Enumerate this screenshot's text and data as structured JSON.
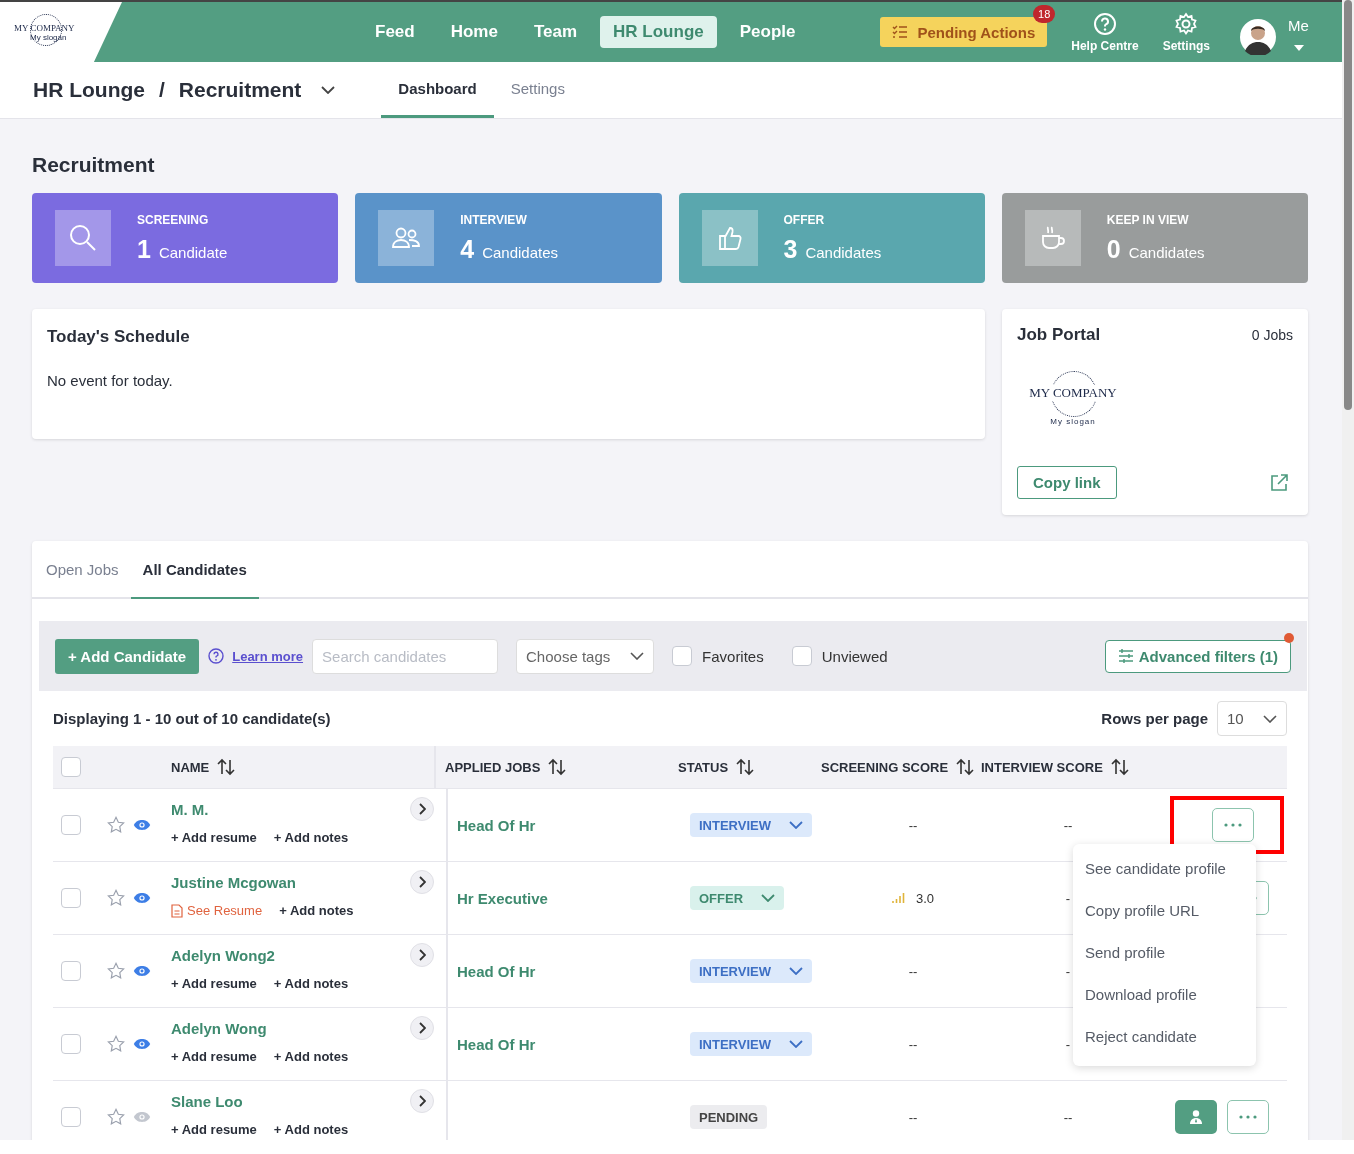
{
  "nav": {
    "logo": {
      "name": "MY COMPANY",
      "slogan": "My slogan"
    },
    "items": [
      {
        "label": "Feed",
        "selected": false
      },
      {
        "label": "Home",
        "selected": false
      },
      {
        "label": "Team",
        "selected": false
      },
      {
        "label": "HR Lounge",
        "selected": true
      },
      {
        "label": "People",
        "selected": false
      }
    ],
    "pending": {
      "label": "Pending Actions",
      "count": "18"
    },
    "tools": [
      {
        "kind": "help",
        "label": "Help Centre"
      },
      {
        "kind": "settings",
        "label": "Settings"
      }
    ],
    "user": {
      "label": "Me"
    }
  },
  "breadcrumb": {
    "section": "HR Lounge",
    "separator": "/",
    "page": "Recruitment"
  },
  "page_tabs": [
    {
      "label": "Dashboard",
      "selected": true
    },
    {
      "label": "Settings",
      "selected": false
    }
  ],
  "heading": "Recruitment",
  "stages": [
    {
      "kind": "screening",
      "title": "SCREENING",
      "count": "1",
      "unit": "Candidate",
      "color": "#7b6be0"
    },
    {
      "kind": "interview",
      "title": "INTERVIEW",
      "count": "4",
      "unit": "Candidates",
      "color": "#5a93c9"
    },
    {
      "kind": "offer",
      "title": "OFFER",
      "count": "3",
      "unit": "Candidates",
      "color": "#5aa7ae"
    },
    {
      "kind": "keep",
      "title": "KEEP IN VIEW",
      "count": "0",
      "unit": "Candidates",
      "color": "#999c9c"
    }
  ],
  "schedule": {
    "title": "Today's Schedule",
    "message": "No event for today."
  },
  "job_portal": {
    "title": "Job Portal",
    "count": "0 Jobs",
    "logo": {
      "name": "MY COMPANY",
      "slogan": "My slogan"
    },
    "button": "Copy link"
  },
  "candidate_tabs": [
    {
      "label": "Open Jobs",
      "selected": false
    },
    {
      "label": "All Candidates",
      "selected": true
    }
  ],
  "toolbar": {
    "add_button": "+ Add Candidate",
    "learn_more": "Learn more",
    "search": {
      "placeholder": "Search candidates"
    },
    "tags": {
      "placeholder": "Choose tags"
    },
    "filters": [
      {
        "label": "Favorites",
        "checked": false
      },
      {
        "label": "Unviewed",
        "checked": false
      }
    ],
    "advanced": {
      "label": "Advanced filters (1)",
      "alert": true
    }
  },
  "summary": "Displaying 1 - 10 out of 10 candidate(s)",
  "rows_per_page": {
    "label": "Rows per page",
    "value": "10"
  },
  "table": {
    "select_all_checked": false,
    "columns": [
      "NAME",
      "APPLIED JOBS",
      "STATUS",
      "SCREENING SCORE",
      "INTERVIEW SCORE"
    ],
    "rows": [
      {
        "name": "M. M.",
        "checked": false,
        "favorite": false,
        "viewed": true,
        "resume": {
          "kind": "add",
          "label": "+ Add resume"
        },
        "notes": "+ Add notes",
        "job": "Head Of Hr",
        "status": {
          "kind": "interview",
          "label": "INTERVIEW"
        },
        "screening_score": "--",
        "score_icon": false,
        "interview_score": "--",
        "assign_button": false,
        "more_button": true,
        "highlighted": true
      },
      {
        "name": "Justine Mcgowan",
        "checked": false,
        "favorite": false,
        "viewed": true,
        "resume": {
          "kind": "file",
          "label": "See Resume"
        },
        "notes": "+ Add notes",
        "job": "Hr Executive",
        "status": {
          "kind": "offer",
          "label": "OFFER"
        },
        "screening_score": "3.0",
        "score_icon": true,
        "interview_score": "-",
        "assign_button": false,
        "more_button": true,
        "highlighted": false
      },
      {
        "name": "Adelyn Wong2",
        "checked": false,
        "favorite": false,
        "viewed": true,
        "resume": {
          "kind": "add",
          "label": "+ Add resume"
        },
        "notes": "+ Add notes",
        "job": "Head Of Hr",
        "status": {
          "kind": "interview",
          "label": "INTERVIEW"
        },
        "screening_score": "--",
        "score_icon": false,
        "interview_score": "-",
        "assign_button": false,
        "more_button": false,
        "highlighted": false
      },
      {
        "name": "Adelyn Wong",
        "checked": false,
        "favorite": false,
        "viewed": true,
        "resume": {
          "kind": "add",
          "label": "+ Add resume"
        },
        "notes": "+ Add notes",
        "job": "Head Of Hr",
        "status": {
          "kind": "interview",
          "label": "INTERVIEW"
        },
        "screening_score": "--",
        "score_icon": false,
        "interview_score": "-",
        "assign_button": false,
        "more_button": false,
        "highlighted": false
      },
      {
        "name": "Slane Loo",
        "checked": false,
        "favorite": false,
        "viewed": false,
        "resume": {
          "kind": "add",
          "label": "+ Add resume"
        },
        "notes": "+ Add notes",
        "job": "",
        "status": {
          "kind": "pending",
          "label": "PENDING"
        },
        "screening_score": "--",
        "score_icon": false,
        "interview_score": "--",
        "assign_button": true,
        "more_button": true,
        "highlighted": false
      }
    ]
  },
  "menu": {
    "items": [
      "See candidate profile",
      "Copy profile URL",
      "Send profile",
      "Download profile",
      "Reject candidate"
    ]
  }
}
